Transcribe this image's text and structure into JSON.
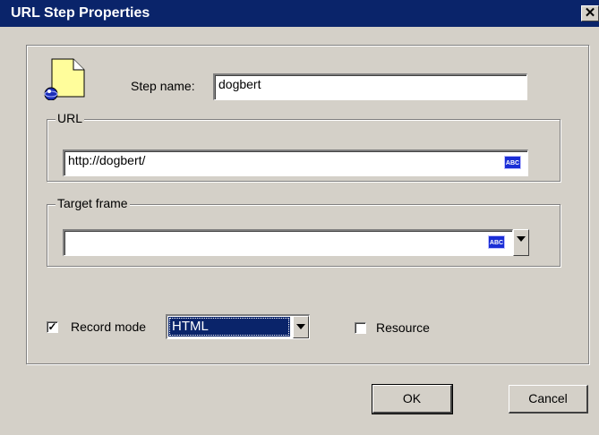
{
  "window": {
    "title": "URL Step Properties",
    "close_glyph": "✕"
  },
  "step_name": {
    "label": "Step name:",
    "value": "dogbert"
  },
  "url_group": {
    "legend": "URL",
    "value": "http://dogbert/",
    "abc_icon": "ABC"
  },
  "target_frame_group": {
    "legend": "Target frame",
    "value": "",
    "abc_icon": "ABC"
  },
  "record_mode": {
    "checked": true,
    "label": "Record mode",
    "selected": "HTML"
  },
  "resource": {
    "checked": false,
    "label": "Resource"
  },
  "buttons": {
    "ok": "OK",
    "cancel": "Cancel"
  },
  "icons": {
    "step": "document-globe-icon"
  },
  "colors": {
    "titlebar": "#0a246a",
    "face": "#d4d0c8",
    "selection": "#0a246a"
  }
}
